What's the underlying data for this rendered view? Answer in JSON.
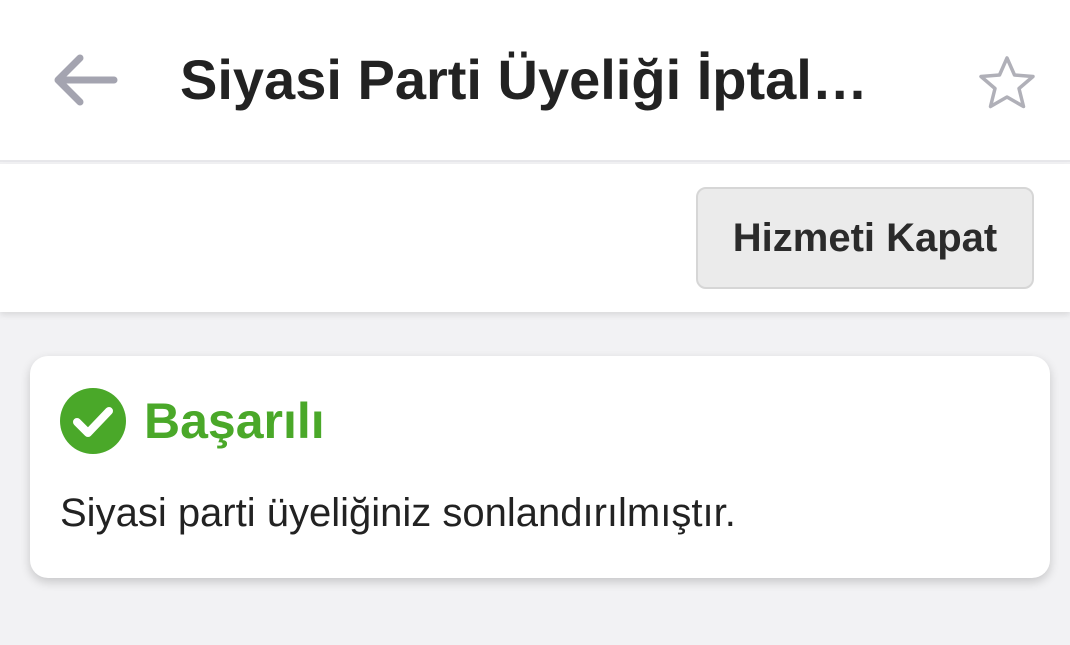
{
  "header": {
    "back_icon": "arrow-left-icon",
    "title": "Siyasi Parti Üyeliği İptal…",
    "favorite_icon": "star-outline-icon"
  },
  "actions": {
    "close_service_label": "Hizmeti Kapat"
  },
  "result_card": {
    "status_icon": "check-circle-icon",
    "status_title": "Başarılı",
    "message": "Siyasi parti üyeliğiniz sonlandırılmıştır."
  },
  "colors": {
    "success_green": "#4aa829",
    "back_arrow": "#a4a4b0",
    "star_outline": "#b0b0b8",
    "text_dark": "#222222",
    "page_background": "#f2f2f4"
  }
}
